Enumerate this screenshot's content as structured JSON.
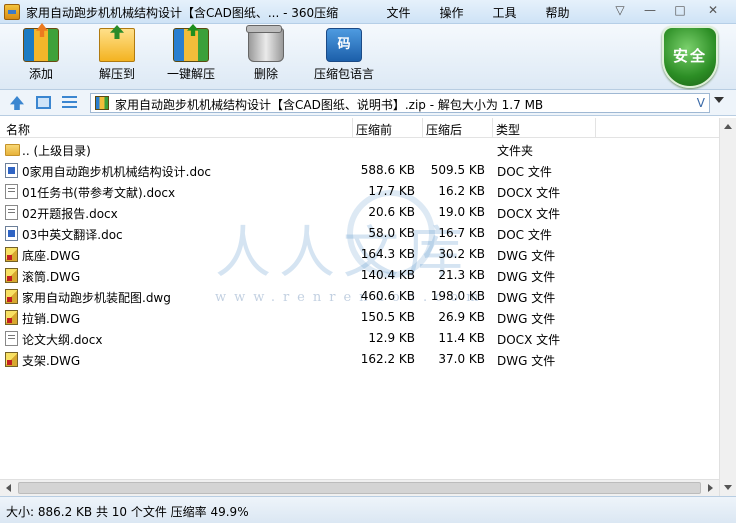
{
  "titlebar": {
    "title": "家用自动跑步机机械结构设计【含CAD图纸、... - 360压缩",
    "menu": [
      "文件",
      "操作",
      "工具",
      "帮助"
    ],
    "window_buttons": [
      "▽",
      "—",
      "□",
      "✕"
    ]
  },
  "toolbar": {
    "buttons": [
      {
        "label": "添加",
        "icon": "add-archive-icon"
      },
      {
        "label": "解压到",
        "icon": "extract-to-icon"
      },
      {
        "label": "一键解压",
        "icon": "one-click-extract-icon"
      },
      {
        "label": "删除",
        "icon": "trash-icon"
      },
      {
        "label": "压缩包语言",
        "icon": "archive-language-icon",
        "glyph": "码"
      }
    ],
    "security_badge": "安全"
  },
  "address": {
    "path": "家用自动跑步机机械结构设计【含CAD图纸、说明书】.zip - 解包大小为 1.7 MB",
    "dropdown": "V"
  },
  "columns": {
    "name": "名称",
    "size": "压缩前",
    "packed": "压缩后",
    "type": "类型"
  },
  "files": [
    {
      "name": ".. (上级目录)",
      "size": "",
      "packed": "",
      "type": "文件夹",
      "icon": "folder"
    },
    {
      "name": "0家用自动跑步机机械结构设计.doc",
      "size": "588.6 KB",
      "packed": "509.5 KB",
      "type": "DOC 文件",
      "icon": "doc"
    },
    {
      "name": "01任务书(带参考文献).docx",
      "size": "17.7 KB",
      "packed": "16.2 KB",
      "type": "DOCX 文件",
      "icon": "docx"
    },
    {
      "name": "02开题报告.docx",
      "size": "20.6 KB",
      "packed": "19.0 KB",
      "type": "DOCX 文件",
      "icon": "docx"
    },
    {
      "name": "03中英文翻译.doc",
      "size": "58.0 KB",
      "packed": "16.7 KB",
      "type": "DOC 文件",
      "icon": "doc"
    },
    {
      "name": "底座.DWG",
      "size": "164.3 KB",
      "packed": "30.2 KB",
      "type": "DWG 文件",
      "icon": "dwg"
    },
    {
      "name": "滚筒.DWG",
      "size": "140.4 KB",
      "packed": "21.3 KB",
      "type": "DWG 文件",
      "icon": "dwg"
    },
    {
      "name": "家用自动跑步机装配图.dwg",
      "size": "460.6 KB",
      "packed": "198.0 KB",
      "type": "DWG 文件",
      "icon": "dwg"
    },
    {
      "name": "拉销.DWG",
      "size": "150.5 KB",
      "packed": "26.9 KB",
      "type": "DWG 文件",
      "icon": "dwg"
    },
    {
      "name": "论文大纲.docx",
      "size": "12.9 KB",
      "packed": "11.4 KB",
      "type": "DOCX 文件",
      "icon": "docx"
    },
    {
      "name": "支架.DWG",
      "size": "162.2 KB",
      "packed": "37.0 KB",
      "type": "DWG 文件",
      "icon": "dwg"
    }
  ],
  "watermark": {
    "text": "人人文库",
    "url": "www.renrendoc.com"
  },
  "status": {
    "text": "大小: 886.2 KB 共 10 个文件 压缩率 49.9%"
  }
}
